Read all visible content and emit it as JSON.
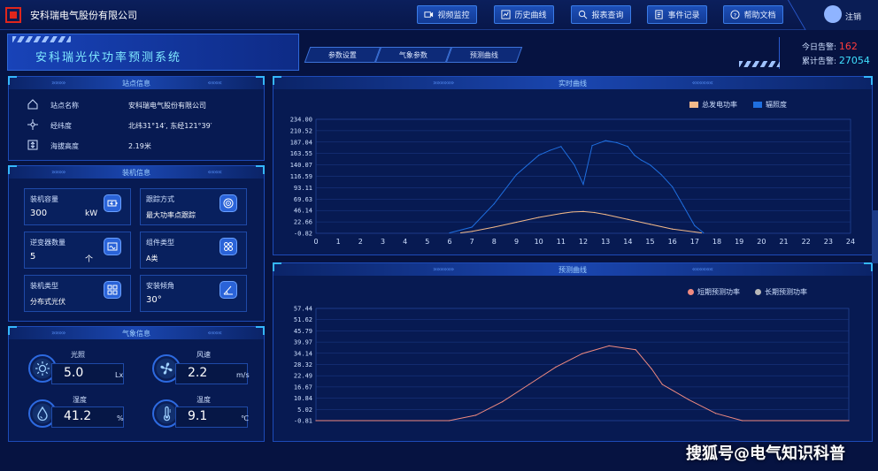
{
  "header": {
    "company": "安科瑞电气股份有限公司",
    "nav": [
      {
        "label": "视频监控",
        "icon": "video-icon"
      },
      {
        "label": "历史曲线",
        "icon": "chart-icon"
      },
      {
        "label": "报表查询",
        "icon": "search-icon"
      },
      {
        "label": "事件记录",
        "icon": "document-icon"
      },
      {
        "label": "帮助文档",
        "icon": "help-icon"
      }
    ],
    "logout": "注销"
  },
  "banner": {
    "title": "安科瑞光伏功率预测系统",
    "tabs": [
      "参数设置",
      "气象参数",
      "预测曲线"
    ]
  },
  "alerts": {
    "today_label": "今日告警:",
    "today_value": "162",
    "total_label": "累计告警:",
    "total_value": "27054"
  },
  "site": {
    "title": "站点信息",
    "rows": [
      {
        "icon": "home-icon",
        "label": "站点名称",
        "value": "安科瑞电气股份有限公司"
      },
      {
        "icon": "location-icon",
        "label": "经纬度",
        "value": "北纬31°14′, 东经121°39′"
      },
      {
        "icon": "altitude-icon",
        "label": "海拔高度",
        "value": "2.19米"
      }
    ]
  },
  "install": {
    "title": "装机信息",
    "cards": [
      {
        "title": "装机容量",
        "value": "300",
        "unit": "kW"
      },
      {
        "title": "跟踪方式",
        "value": "最大功率点跟踪",
        "unit": ""
      },
      {
        "title": "逆变器数量",
        "value": "5",
        "unit": "个"
      },
      {
        "title": "组件类型",
        "value": "A类",
        "unit": ""
      },
      {
        "title": "装机类型",
        "value": "分布式光伏",
        "unit": ""
      },
      {
        "title": "安装倾角",
        "value": "30°",
        "unit": ""
      }
    ]
  },
  "weather": {
    "title": "气象信息",
    "items": [
      {
        "label": "光照",
        "value": "5.0",
        "unit": "Lx",
        "icon": "sun-icon"
      },
      {
        "label": "风速",
        "value": "2.2",
        "unit": "m/s",
        "icon": "fan-icon"
      },
      {
        "label": "湿度",
        "value": "41.2",
        "unit": "%",
        "icon": "humidity-icon"
      },
      {
        "label": "温度",
        "value": "9.1",
        "unit": "℃",
        "icon": "thermometer-icon"
      }
    ]
  },
  "realtime": {
    "title": "实时曲线",
    "legend": [
      "总发电功率",
      "辐照度"
    ],
    "colors": {
      "power": "#f2b98a",
      "irradiance": "#1f6fe0"
    }
  },
  "forecast": {
    "title": "预测曲线",
    "legend": [
      "短期预测功率",
      "长期预测功率"
    ],
    "colors": {
      "short": "#f08a80",
      "long": "#b8b8b8"
    }
  },
  "chart_data": [
    {
      "type": "line",
      "title": "实时曲线",
      "x_ticks": [
        0,
        1,
        2,
        3,
        4,
        5,
        6,
        7,
        8,
        9,
        10,
        11,
        12,
        13,
        14,
        15,
        16,
        17,
        18,
        19,
        20,
        21,
        22,
        23,
        24
      ],
      "y_ticks": [
        "234.00",
        "210.52",
        "187.04",
        "163.55",
        "140.07",
        "116.59",
        "93.11",
        "69.63",
        "46.14",
        "22.66",
        "-0.82"
      ],
      "ylim": [
        -0.82,
        234.0
      ],
      "xlim": [
        0,
        24
      ],
      "series": [
        {
          "name": "总发电功率",
          "x": [
            6.5,
            7,
            8,
            9,
            10,
            11,
            11.5,
            12,
            12.5,
            13,
            14,
            15,
            16,
            17,
            17.3
          ],
          "y": [
            0,
            3,
            12,
            22,
            32,
            40,
            43,
            44,
            42,
            38,
            28,
            18,
            8,
            2,
            0
          ]
        },
        {
          "name": "辐照度",
          "x": [
            6,
            7,
            8,
            9,
            10,
            10.5,
            11,
            11.6,
            12,
            12.4,
            13,
            13.5,
            14,
            14.3,
            14.6,
            15,
            15.5,
            16,
            16.5,
            17,
            17.4
          ],
          "y": [
            0,
            12,
            60,
            120,
            160,
            170,
            178,
            140,
            100,
            180,
            190,
            186,
            178,
            160,
            150,
            140,
            120,
            95,
            55,
            15,
            0
          ]
        }
      ]
    },
    {
      "type": "line",
      "title": "预测曲线",
      "y_ticks": [
        "57.44",
        "51.62",
        "45.79",
        "39.97",
        "34.14",
        "28.32",
        "22.49",
        "16.67",
        "10.84",
        "5.02",
        "-0.81"
      ],
      "ylim": [
        -0.81,
        57.44
      ],
      "series": [
        {
          "name": "短期预测功率",
          "x": [
            0,
            0.25,
            0.3,
            0.35,
            0.4,
            0.45,
            0.5,
            0.55,
            0.6,
            0.63,
            0.65,
            0.7,
            0.75,
            0.8,
            1.0
          ],
          "y": [
            -0.81,
            -0.81,
            2,
            9,
            18,
            27,
            34,
            38,
            36,
            26,
            18,
            10,
            3,
            -0.81,
            -0.81
          ]
        }
      ]
    }
  ]
}
